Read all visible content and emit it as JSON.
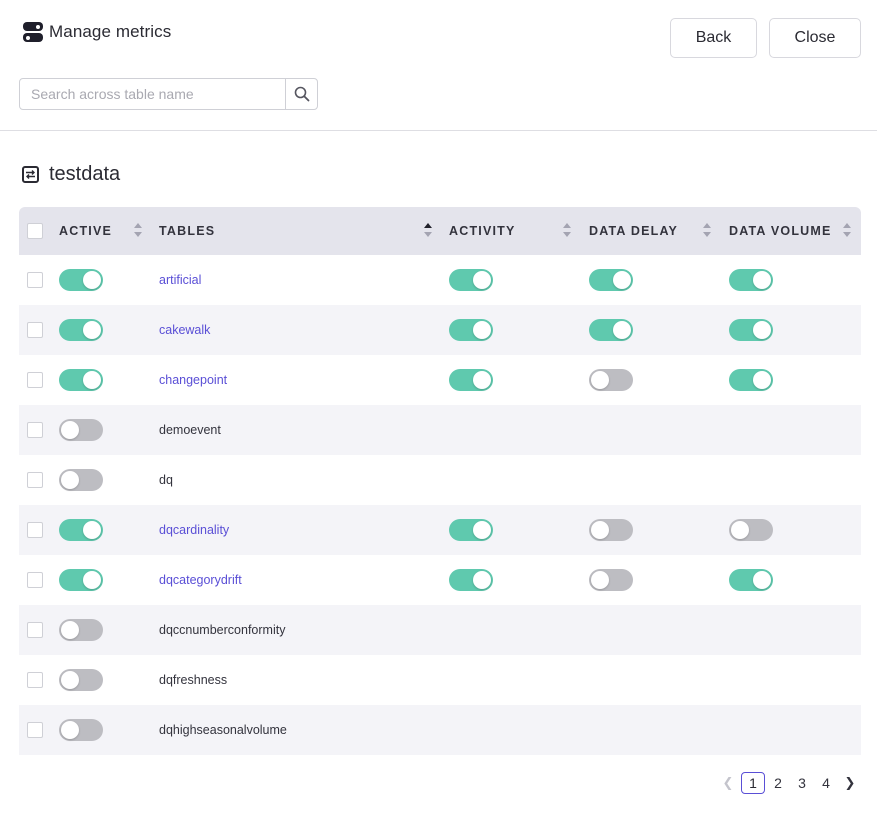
{
  "header": {
    "title": "Manage metrics",
    "back_label": "Back",
    "close_label": "Close"
  },
  "search": {
    "placeholder": "Search across table name",
    "value": ""
  },
  "section": {
    "title": "testdata"
  },
  "table": {
    "columns": {
      "active": "ACTIVE",
      "tables": "TABLES",
      "activity": "ACTIVITY",
      "data_delay": "DATA DELAY",
      "data_volume": "DATA VOLUME"
    },
    "rows": [
      {
        "name": "artificial",
        "active": true,
        "activity": true,
        "data_delay": true,
        "data_volume": true
      },
      {
        "name": "cakewalk",
        "active": true,
        "activity": true,
        "data_delay": true,
        "data_volume": true
      },
      {
        "name": "changepoint",
        "active": true,
        "activity": true,
        "data_delay": false,
        "data_volume": true
      },
      {
        "name": "demoevent",
        "active": false,
        "activity": null,
        "data_delay": null,
        "data_volume": null
      },
      {
        "name": "dq",
        "active": false,
        "activity": null,
        "data_delay": null,
        "data_volume": null
      },
      {
        "name": "dqcardinality",
        "active": true,
        "activity": true,
        "data_delay": false,
        "data_volume": false
      },
      {
        "name": "dqcategorydrift",
        "active": true,
        "activity": true,
        "data_delay": false,
        "data_volume": true
      },
      {
        "name": "dqccnumberconformity",
        "active": false,
        "activity": null,
        "data_delay": null,
        "data_volume": null
      },
      {
        "name": "dqfreshness",
        "active": false,
        "activity": null,
        "data_delay": null,
        "data_volume": null
      },
      {
        "name": "dqhighseasonalvolume",
        "active": false,
        "activity": null,
        "data_delay": null,
        "data_volume": null
      }
    ]
  },
  "pagination": {
    "pages": [
      "1",
      "2",
      "3",
      "4"
    ],
    "current": "1"
  },
  "colors": {
    "toggle_on": "#5fc9ae",
    "toggle_off": "#bdbdc2",
    "link": "#5a4fd6",
    "header_bg": "#e4e4ec"
  }
}
